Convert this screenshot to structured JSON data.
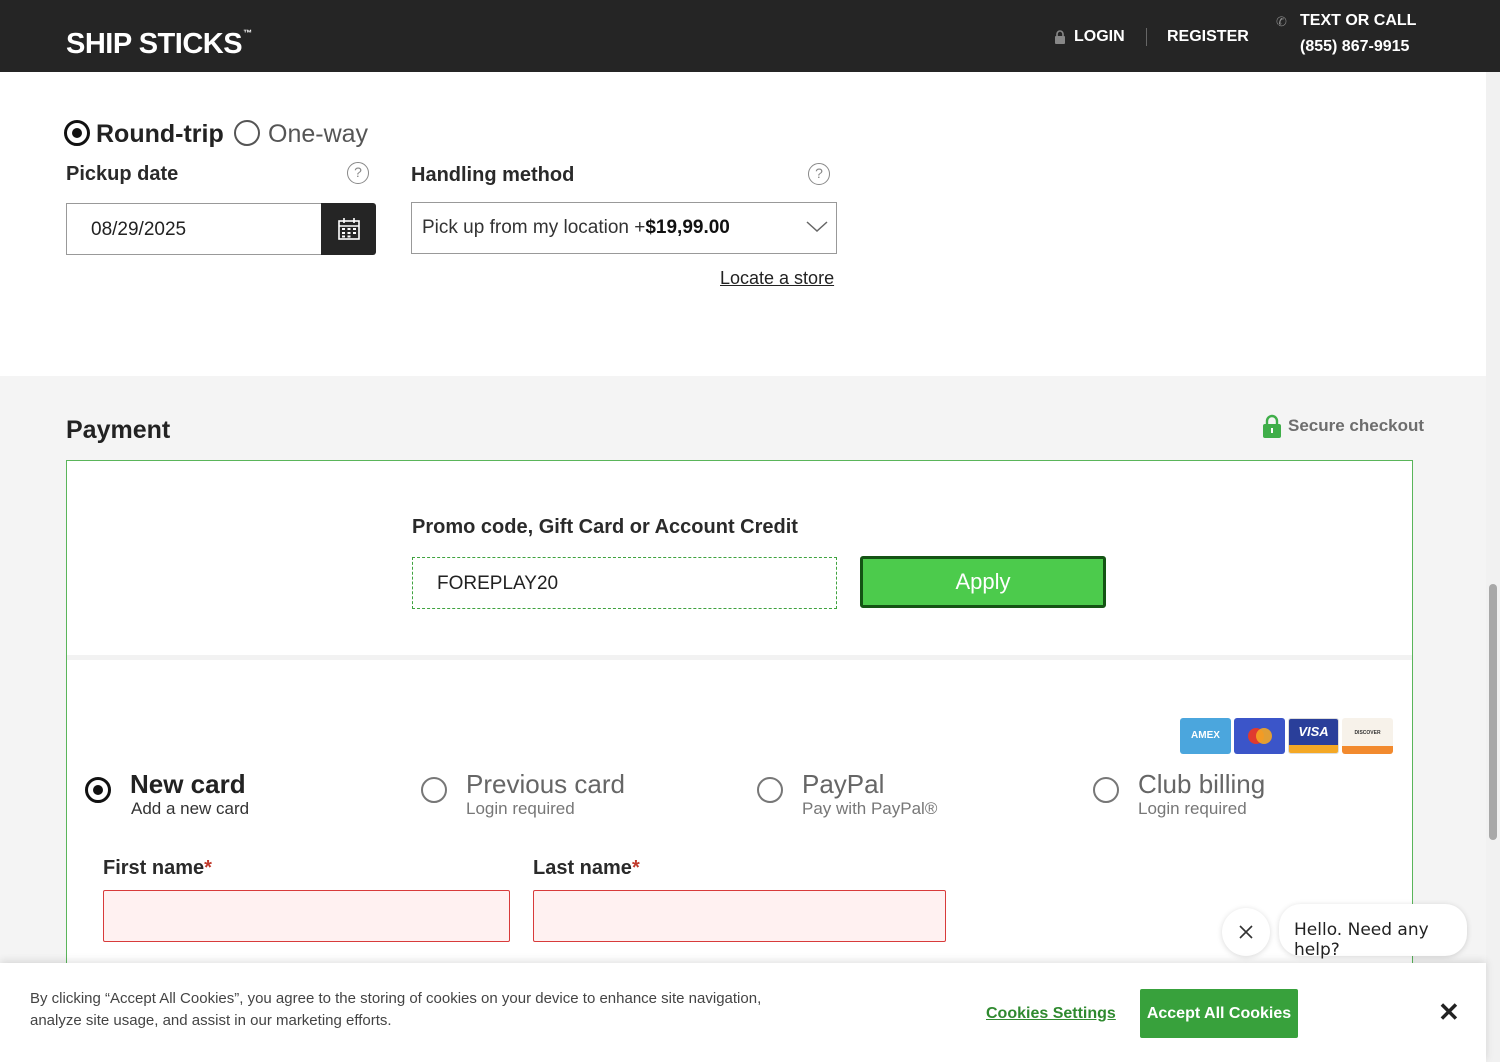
{
  "header": {
    "logo": "SHIP STICKS",
    "logo_tm": "™",
    "login": "LOGIN",
    "register": "REGISTER",
    "call_label": "TEXT OR CALL",
    "call_number": "(855) 867-9915"
  },
  "trip": {
    "round_trip": "Round-trip",
    "one_way": "One-way",
    "selected": "Round-trip"
  },
  "pickup": {
    "label": "Pickup date",
    "value": "08/29/2025"
  },
  "handling": {
    "label": "Handling method",
    "value_text": "Pick up from my location +",
    "value_price": "$19,99.00",
    "locate_link": "Locate a store"
  },
  "payment": {
    "title": "Payment",
    "secure": "Secure checkout",
    "promo_label": "Promo code, Gift Card or Account Credit",
    "promo_value": "FOREPLAY20",
    "apply": "Apply",
    "card_logos": [
      "AMEX",
      "MASTERCARD",
      "VISA",
      "DISCOVER"
    ],
    "methods": [
      {
        "title": "New card",
        "subtitle": "Add a new card",
        "selected": true
      },
      {
        "title": "Previous card",
        "subtitle": "Login required",
        "selected": false
      },
      {
        "title": "PayPal",
        "subtitle": "Pay with PayPal®",
        "selected": false
      },
      {
        "title": "Club billing",
        "subtitle": "Login required",
        "selected": false
      }
    ],
    "first_name_label": "First name",
    "last_name_label": "Last name",
    "required_mark": "*"
  },
  "chat": {
    "message": "Hello. Need any help?"
  },
  "cookie": {
    "text": "By clicking “Accept All Cookies”, you agree to the storing of cookies on your device to enhance site navigation, analyze site usage, and assist in our marketing efforts.",
    "settings": "Cookies Settings",
    "accept": "Accept All Cookies"
  },
  "colors": {
    "brand_dark": "#252525",
    "accent_green": "#4ccb4c",
    "cookie_green": "#38a13c",
    "error_red": "#d83b3b"
  }
}
